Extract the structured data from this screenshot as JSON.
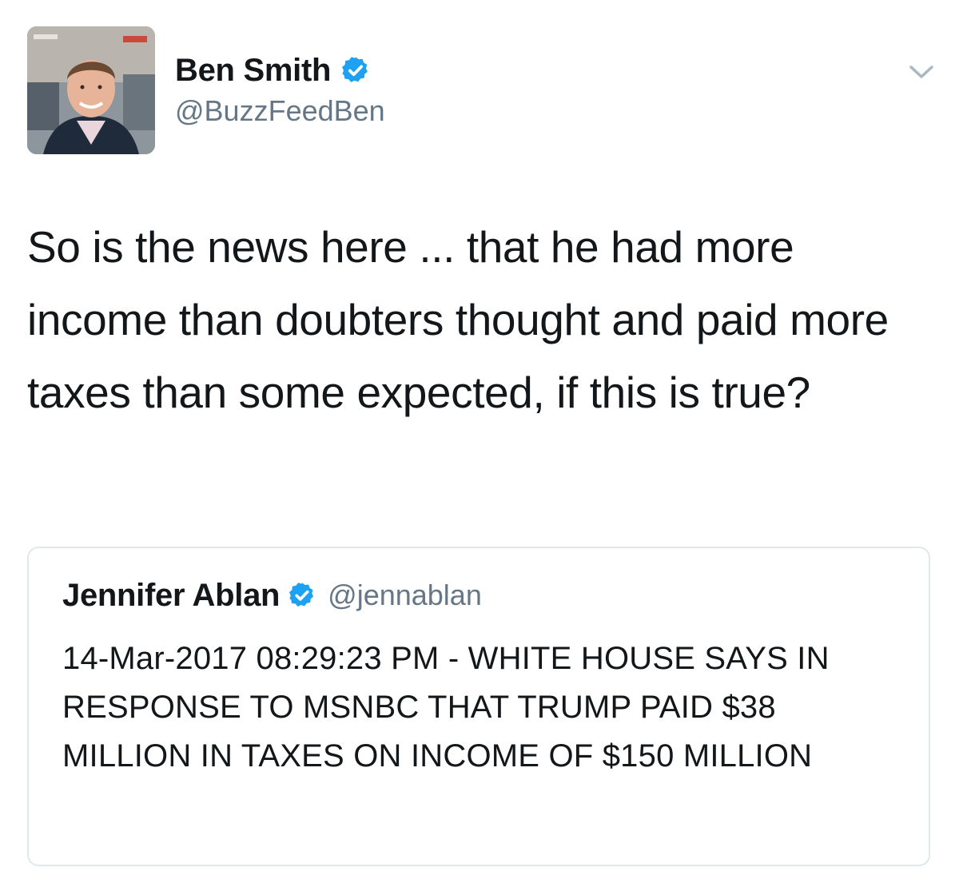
{
  "tweet": {
    "author": {
      "name": "Ben Smith",
      "handle": "@BuzzFeedBen",
      "verified": true
    },
    "text": "So is the news here ... that he had more income than doubters thought and paid more taxes than some expected, if this is true?",
    "menu_icon": "chevron-down-icon"
  },
  "quoted_tweet": {
    "author": {
      "name": "Jennifer Ablan",
      "handle": "@jennablan",
      "verified": true
    },
    "text": "14-Mar-2017 08:29:23 PM - WHITE HOUSE SAYS IN RESPONSE TO MSNBC THAT TRUMP PAID $38 MILLION IN TAXES ON INCOME OF $150 MILLION"
  },
  "colors": {
    "verified_badge": "#1da1f2",
    "handle_text": "#657786",
    "card_border": "#e1e8ed"
  }
}
